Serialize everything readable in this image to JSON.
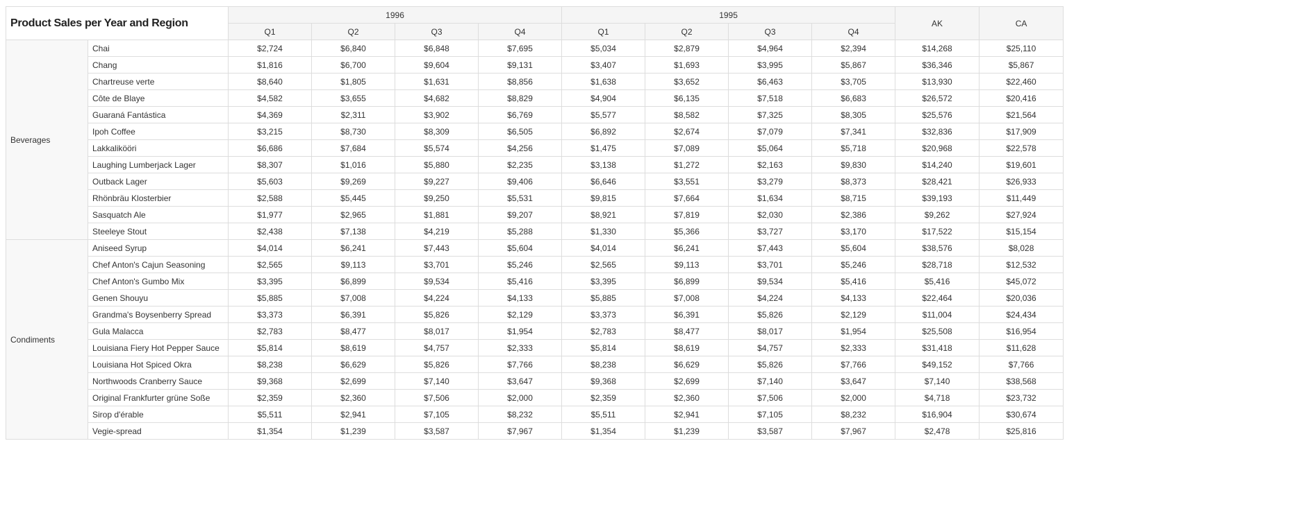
{
  "pivot": {
    "title": "Product Sales per Year and Region",
    "years": [
      "1996",
      "1995"
    ],
    "quarters": [
      "Q1",
      "Q2",
      "Q3",
      "Q4"
    ],
    "regions": [
      "AK",
      "CA"
    ],
    "groups": [
      {
        "category": "Beverages",
        "rows": [
          {
            "product": "Chai",
            "values": [
              "$2,724",
              "$6,840",
              "$6,848",
              "$7,695",
              "$5,034",
              "$2,879",
              "$4,964",
              "$2,394",
              "$14,268",
              "$25,110"
            ]
          },
          {
            "product": "Chang",
            "values": [
              "$1,816",
              "$6,700",
              "$9,604",
              "$9,131",
              "$3,407",
              "$1,693",
              "$3,995",
              "$5,867",
              "$36,346",
              "$5,867"
            ]
          },
          {
            "product": "Chartreuse verte",
            "values": [
              "$8,640",
              "$1,805",
              "$1,631",
              "$8,856",
              "$1,638",
              "$3,652",
              "$6,463",
              "$3,705",
              "$13,930",
              "$22,460"
            ]
          },
          {
            "product": "Côte de Blaye",
            "values": [
              "$4,582",
              "$3,655",
              "$4,682",
              "$8,829",
              "$4,904",
              "$6,135",
              "$7,518",
              "$6,683",
              "$26,572",
              "$20,416"
            ]
          },
          {
            "product": "Guaraná Fantástica",
            "values": [
              "$4,369",
              "$2,311",
              "$3,902",
              "$6,769",
              "$5,577",
              "$8,582",
              "$7,325",
              "$8,305",
              "$25,576",
              "$21,564"
            ]
          },
          {
            "product": "Ipoh Coffee",
            "values": [
              "$3,215",
              "$8,730",
              "$8,309",
              "$6,505",
              "$6,892",
              "$2,674",
              "$7,079",
              "$7,341",
              "$32,836",
              "$17,909"
            ]
          },
          {
            "product": "Lakkalikööri",
            "values": [
              "$6,686",
              "$7,684",
              "$5,574",
              "$4,256",
              "$1,475",
              "$7,089",
              "$5,064",
              "$5,718",
              "$20,968",
              "$22,578"
            ]
          },
          {
            "product": "Laughing Lumberjack Lager",
            "values": [
              "$8,307",
              "$1,016",
              "$5,880",
              "$2,235",
              "$3,138",
              "$1,272",
              "$2,163",
              "$9,830",
              "$14,240",
              "$19,601"
            ]
          },
          {
            "product": "Outback Lager",
            "values": [
              "$5,603",
              "$9,269",
              "$9,227",
              "$9,406",
              "$6,646",
              "$3,551",
              "$3,279",
              "$8,373",
              "$28,421",
              "$26,933"
            ]
          },
          {
            "product": "Rhönbräu Klosterbier",
            "values": [
              "$2,588",
              "$5,445",
              "$9,250",
              "$5,531",
              "$9,815",
              "$7,664",
              "$1,634",
              "$8,715",
              "$39,193",
              "$11,449"
            ]
          },
          {
            "product": "Sasquatch Ale",
            "values": [
              "$1,977",
              "$2,965",
              "$1,881",
              "$9,207",
              "$8,921",
              "$7,819",
              "$2,030",
              "$2,386",
              "$9,262",
              "$27,924"
            ]
          },
          {
            "product": "Steeleye Stout",
            "values": [
              "$2,438",
              "$7,138",
              "$4,219",
              "$5,288",
              "$1,330",
              "$5,366",
              "$3,727",
              "$3,170",
              "$17,522",
              "$15,154"
            ]
          }
        ]
      },
      {
        "category": "Condiments",
        "rows": [
          {
            "product": "Aniseed Syrup",
            "values": [
              "$4,014",
              "$6,241",
              "$7,443",
              "$5,604",
              "$4,014",
              "$6,241",
              "$7,443",
              "$5,604",
              "$38,576",
              "$8,028"
            ]
          },
          {
            "product": "Chef Anton's Cajun Seasoning",
            "values": [
              "$2,565",
              "$9,113",
              "$3,701",
              "$5,246",
              "$2,565",
              "$9,113",
              "$3,701",
              "$5,246",
              "$28,718",
              "$12,532"
            ]
          },
          {
            "product": "Chef Anton's Gumbo Mix",
            "values": [
              "$3,395",
              "$6,899",
              "$9,534",
              "$5,416",
              "$3,395",
              "$6,899",
              "$9,534",
              "$5,416",
              "$5,416",
              "$45,072"
            ]
          },
          {
            "product": "Genen Shouyu",
            "values": [
              "$5,885",
              "$7,008",
              "$4,224",
              "$4,133",
              "$5,885",
              "$7,008",
              "$4,224",
              "$4,133",
              "$22,464",
              "$20,036"
            ]
          },
          {
            "product": "Grandma's Boysenberry Spread",
            "values": [
              "$3,373",
              "$6,391",
              "$5,826",
              "$2,129",
              "$3,373",
              "$6,391",
              "$5,826",
              "$2,129",
              "$11,004",
              "$24,434"
            ]
          },
          {
            "product": "Gula Malacca",
            "values": [
              "$2,783",
              "$8,477",
              "$8,017",
              "$1,954",
              "$2,783",
              "$8,477",
              "$8,017",
              "$1,954",
              "$25,508",
              "$16,954"
            ]
          },
          {
            "product": "Louisiana Fiery Hot Pepper Sauce",
            "values": [
              "$5,814",
              "$8,619",
              "$4,757",
              "$2,333",
              "$5,814",
              "$8,619",
              "$4,757",
              "$2,333",
              "$31,418",
              "$11,628"
            ]
          },
          {
            "product": "Louisiana Hot Spiced Okra",
            "values": [
              "$8,238",
              "$6,629",
              "$5,826",
              "$7,766",
              "$8,238",
              "$6,629",
              "$5,826",
              "$7,766",
              "$49,152",
              "$7,766"
            ]
          },
          {
            "product": "Northwoods Cranberry Sauce",
            "values": [
              "$9,368",
              "$2,699",
              "$7,140",
              "$3,647",
              "$9,368",
              "$2,699",
              "$7,140",
              "$3,647",
              "$7,140",
              "$38,568"
            ]
          },
          {
            "product": "Original Frankfurter grüne Soße",
            "values": [
              "$2,359",
              "$2,360",
              "$7,506",
              "$2,000",
              "$2,359",
              "$2,360",
              "$7,506",
              "$2,000",
              "$4,718",
              "$23,732"
            ]
          },
          {
            "product": "Sirop d'érable",
            "values": [
              "$5,511",
              "$2,941",
              "$7,105",
              "$8,232",
              "$5,511",
              "$2,941",
              "$7,105",
              "$8,232",
              "$16,904",
              "$30,674"
            ]
          },
          {
            "product": "Vegie-spread",
            "values": [
              "$1,354",
              "$1,239",
              "$3,587",
              "$7,967",
              "$1,354",
              "$1,239",
              "$3,587",
              "$7,967",
              "$2,478",
              "$25,816"
            ]
          }
        ]
      }
    ]
  }
}
